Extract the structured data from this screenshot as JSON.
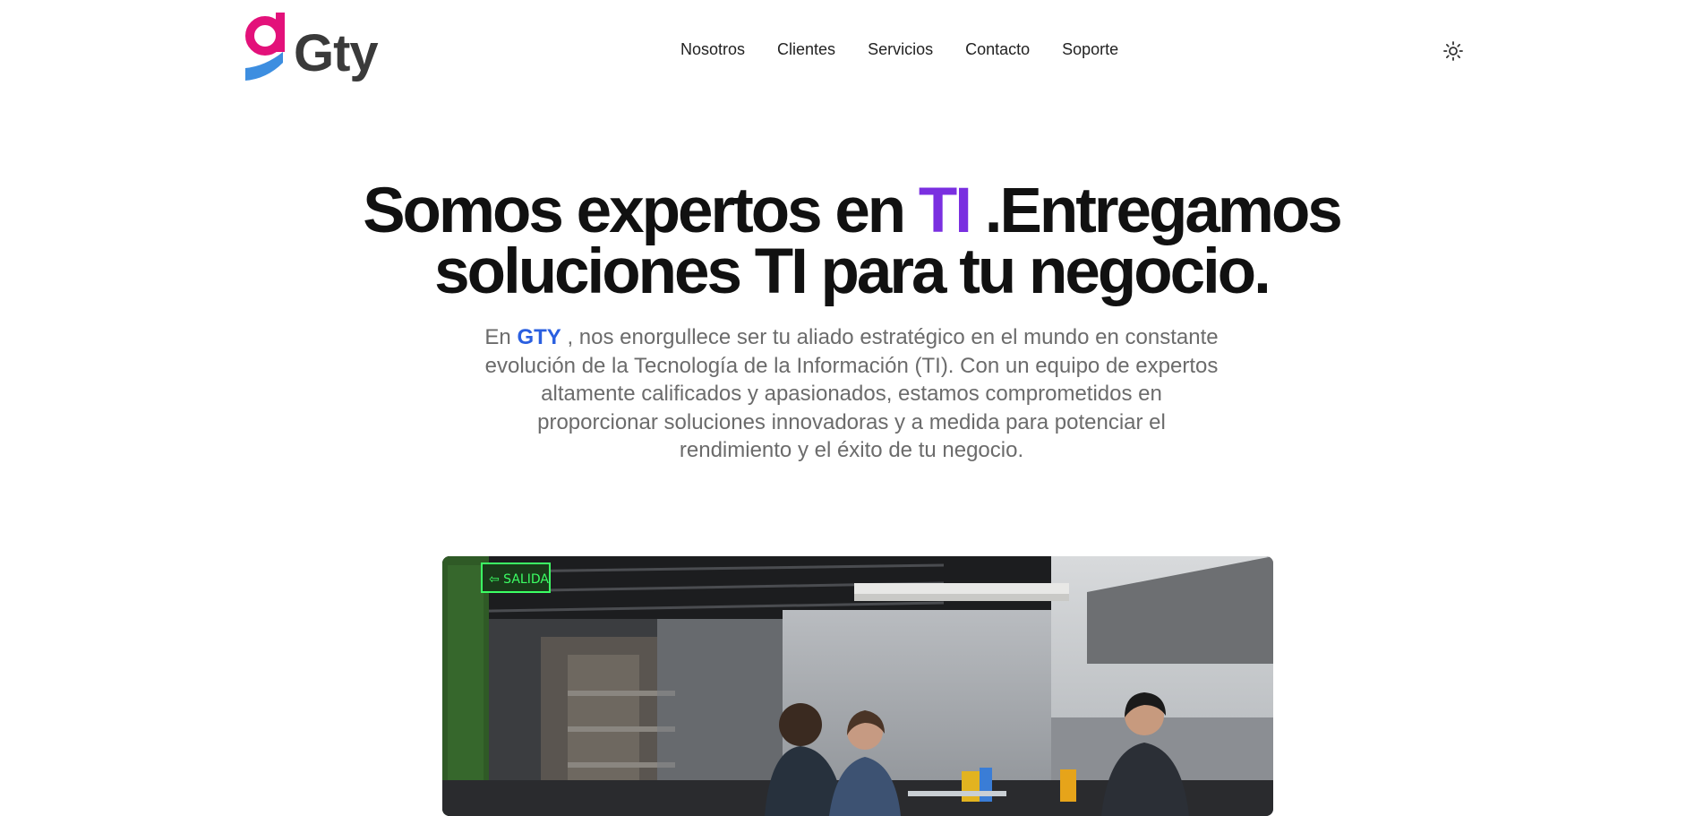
{
  "brand": {
    "logo_text": "Gty",
    "logo_colors": {
      "magenta": "#e3117a",
      "blue": "#3d8ee0",
      "dark": "#3a3a3a"
    }
  },
  "nav": {
    "items": [
      {
        "label": "Nosotros"
      },
      {
        "label": "Clientes"
      },
      {
        "label": "Servicios"
      },
      {
        "label": "Contacto"
      },
      {
        "label": "Soporte"
      }
    ],
    "theme_toggle_icon": "sun-icon"
  },
  "hero": {
    "title_part1": "Somos expertos en ",
    "title_accent": "TI",
    "title_part2": " .Entregamos soluciones TI para tu negocio.",
    "description_prefix": "En ",
    "description_brand": "GTY",
    "description_text": " , nos enorgullece ser tu aliado estratégico en el mundo en constante evolución de la Tecnología de la Información (TI). Con un equipo de expertos altamente calificados y apasionados, estamos comprometidos en proporcionar soluciones innovadoras y a medida para potenciar el rendimiento y el éxito de tu negocio."
  },
  "colors": {
    "accent_purple": "#7a2fe0",
    "brand_blue": "#2a5fe0",
    "body_text": "#6b6b6b",
    "heading": "#111111"
  },
  "image": {
    "icon": "team-photo",
    "exit_sign_text": "SALIDA"
  }
}
